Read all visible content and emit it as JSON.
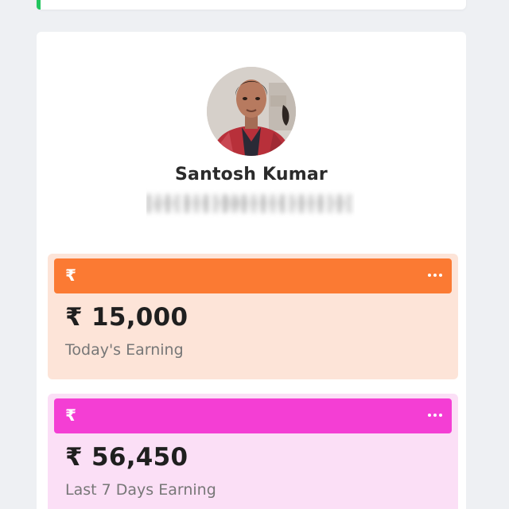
{
  "profile": {
    "name": "Santosh Kumar",
    "subtitle": "v•• ••• •58••••• •••• ••"
  },
  "stats": [
    {
      "currency_symbol": "₹",
      "value": "₹ 15,000",
      "label": "Today's Earning",
      "accent_color": "#fb7a33",
      "background_color": "#fde4d8",
      "icon": "rupee-icon",
      "menu_icon": "more-horizontal-icon"
    },
    {
      "currency_symbol": "₹",
      "value": "₹ 56,450",
      "label": "Last 7 Days Earning",
      "accent_color": "#f43ed4",
      "background_color": "#fbdff6",
      "icon": "rupee-icon",
      "menu_icon": "more-horizontal-icon"
    }
  ],
  "colors": {
    "page_background": "#eef0f3",
    "card_background": "#ffffff",
    "top_accent": "#22c55e"
  }
}
